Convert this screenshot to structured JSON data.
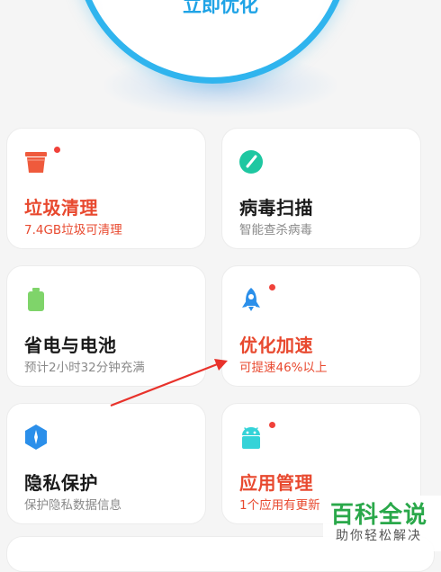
{
  "hero": {
    "button_label": "立即优化"
  },
  "cards": [
    {
      "title": "垃圾清理",
      "subtitle": "7.4GB垃圾可清理",
      "icon": "trash-icon",
      "color": "#ef5a3c",
      "badge": true,
      "highlight": true
    },
    {
      "title": "病毒扫描",
      "subtitle": "智能查杀病毒",
      "icon": "virus-scan-icon",
      "color": "#1ec7a1",
      "badge": false,
      "highlight": false
    },
    {
      "title": "省电与电池",
      "subtitle": "预计2小时32分钟充满",
      "icon": "battery-icon",
      "color": "#7fd46a",
      "badge": false,
      "highlight": false
    },
    {
      "title": "优化加速",
      "subtitle": "可提速46%以上",
      "icon": "rocket-icon",
      "color": "#2b8fea",
      "badge": true,
      "highlight": true
    },
    {
      "title": "隐私保护",
      "subtitle": "保护隐私数据信息",
      "icon": "privacy-shield-icon",
      "color": "#2b8fea",
      "badge": false,
      "highlight": false
    },
    {
      "title": "应用管理",
      "subtitle": "1个应用有更新",
      "icon": "android-icon",
      "color": "#34d3d8",
      "badge": true,
      "highlight": true
    }
  ],
  "watermark": {
    "title": "百科全说",
    "subtitle": "助你轻松解决"
  },
  "colors": {
    "accent_red": "#e8492f",
    "ring_blue": "#2fb4ee",
    "annotation_arrow": "#e8322b"
  }
}
